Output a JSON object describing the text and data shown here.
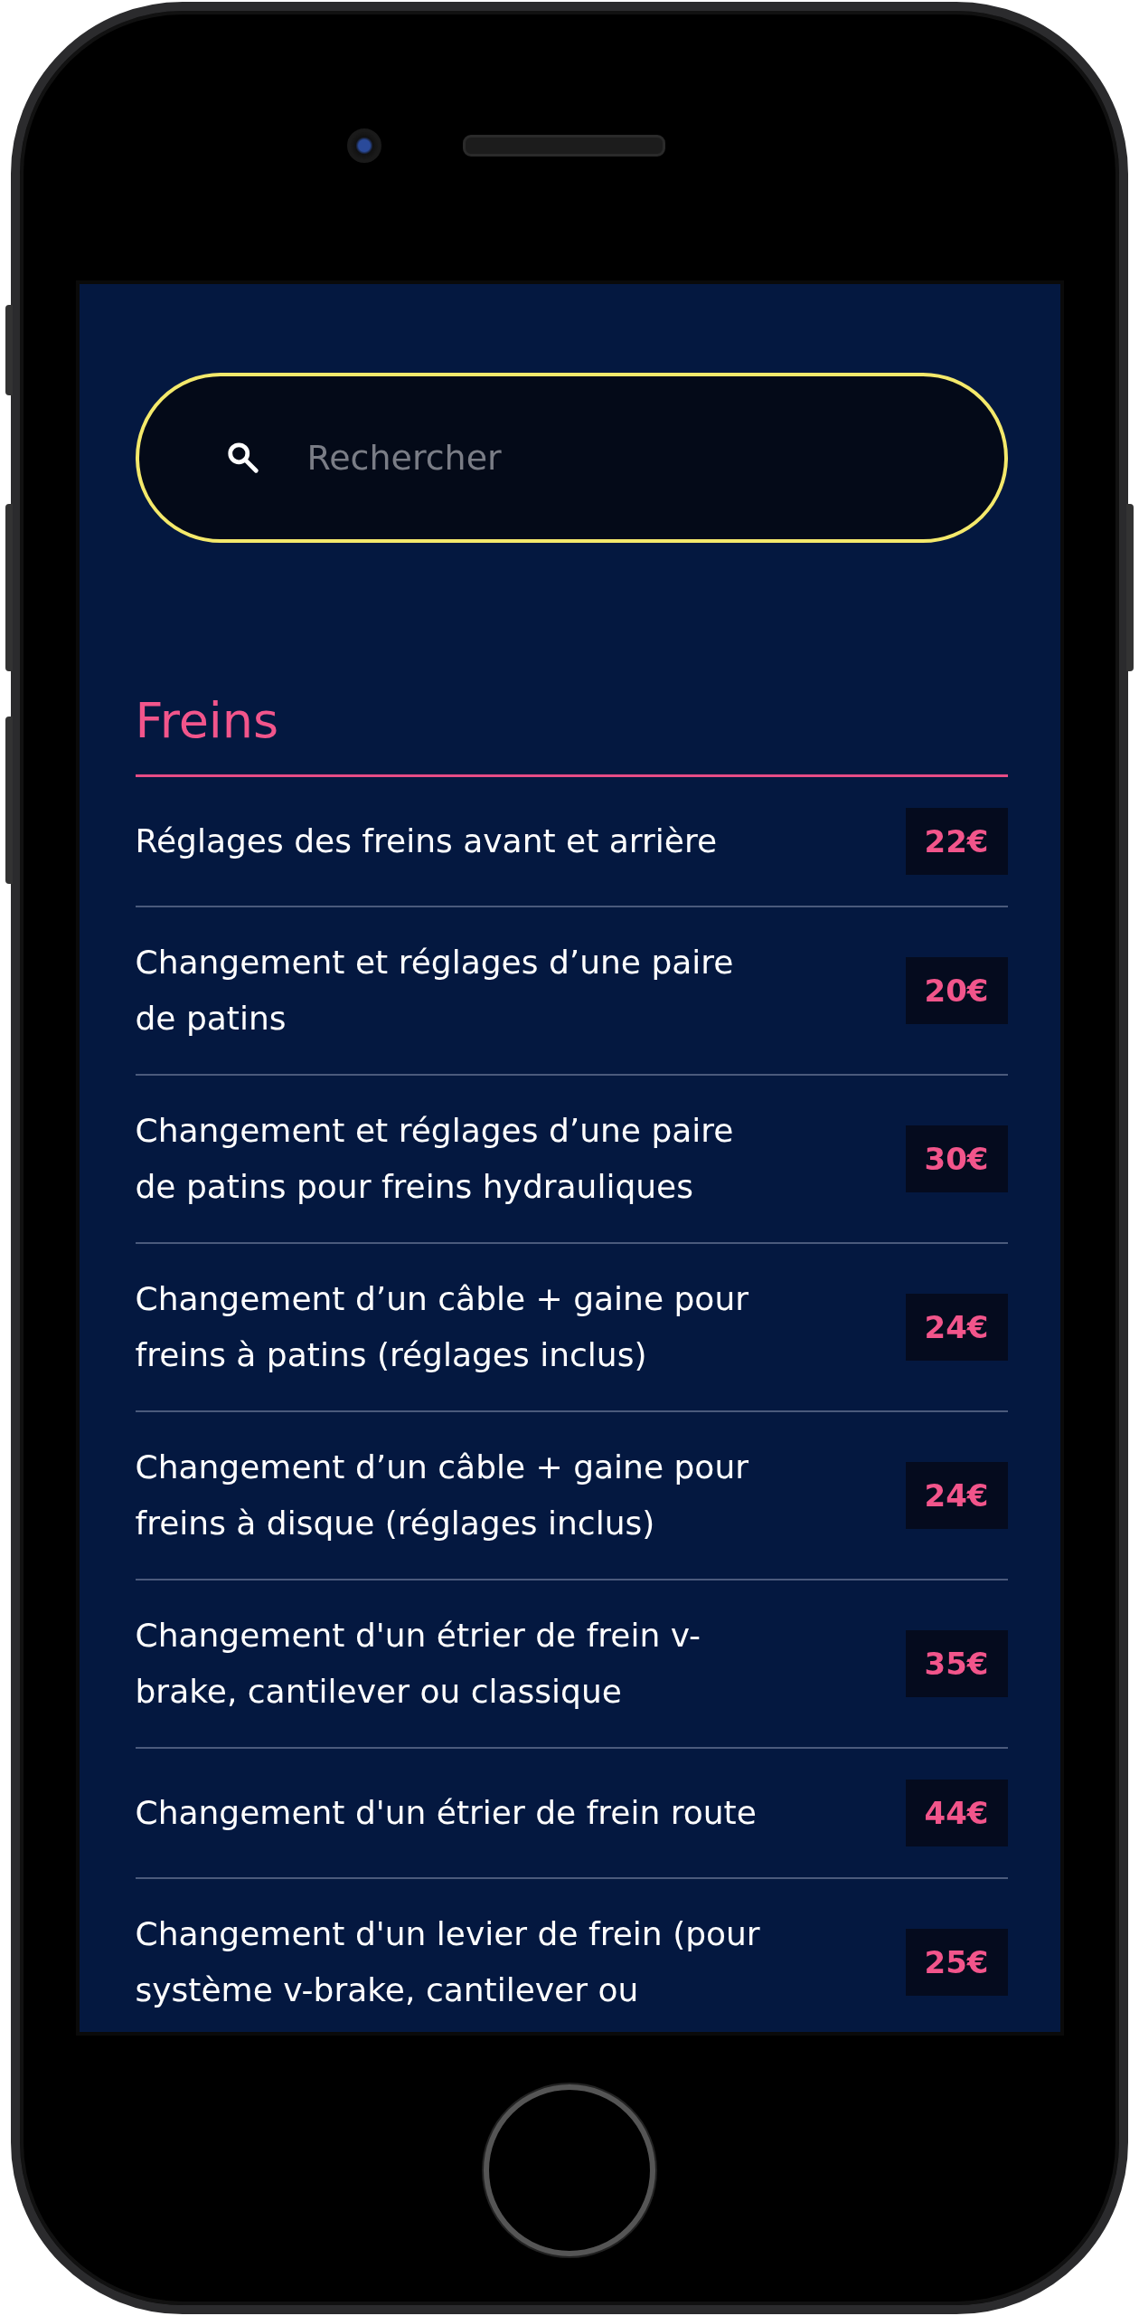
{
  "search": {
    "placeholder": "Rechercher"
  },
  "section": {
    "title": "Freins"
  },
  "services": [
    {
      "label": "Réglages des freins avant et arrière",
      "price": "22€"
    },
    {
      "label": "Changement et réglages d’une paire de patins",
      "price": "20€"
    },
    {
      "label": "Changement et réglages d’une paire de patins pour freins hydrauliques",
      "price": "30€"
    },
    {
      "label": "Changement d’un câble + gaine pour freins à patins (réglages inclus)",
      "price": "24€"
    },
    {
      "label": "Changement d’un câble + gaine pour freins à disque (réglages inclus)",
      "price": "24€"
    },
    {
      "label": "Changement d'un étrier de frein v-brake, cantilever ou classique",
      "price": "35€"
    },
    {
      "label": "Changement d'un étrier de frein route",
      "price": "44€"
    },
    {
      "label": "Changement d'un levier de frein (pour système v-brake, cantilever ou",
      "price": "25€"
    }
  ]
}
